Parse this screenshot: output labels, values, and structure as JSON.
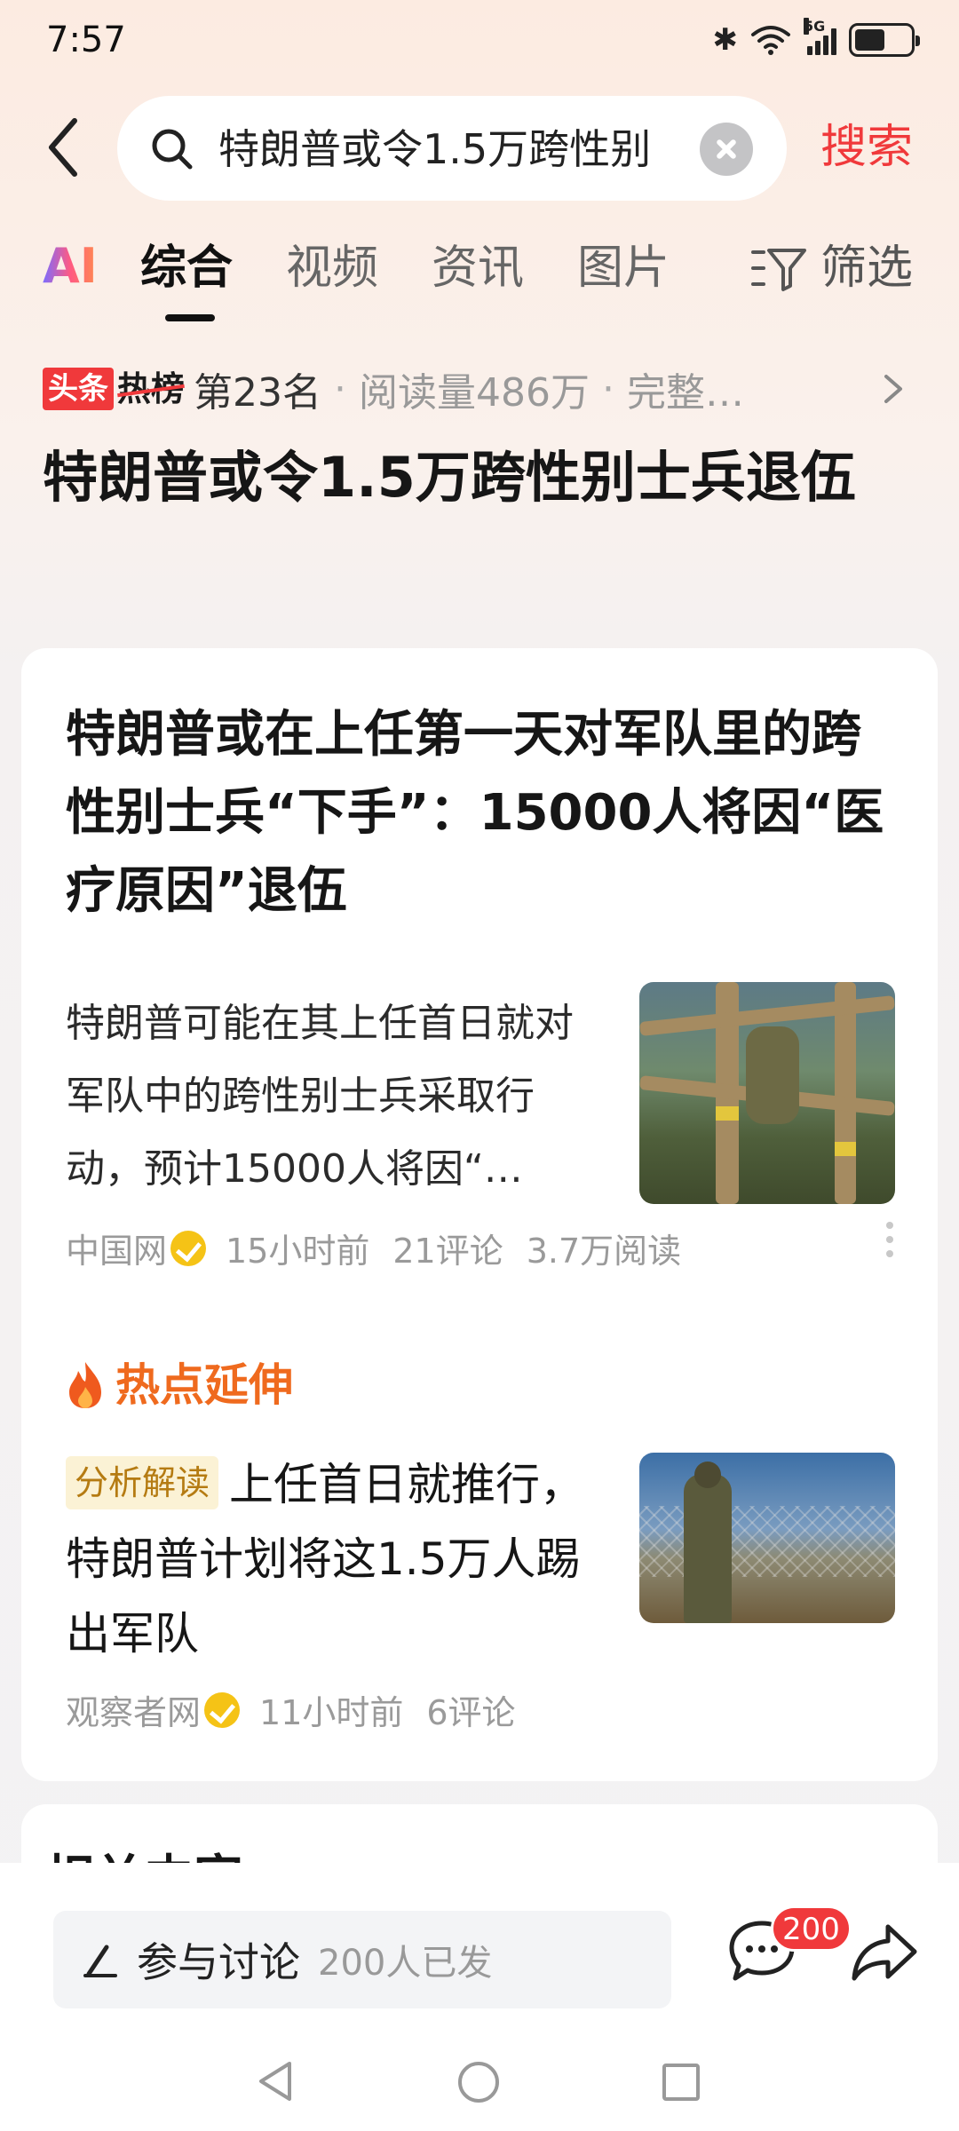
{
  "status_bar": {
    "time": "7:57",
    "network": "5G",
    "battery_level": 0.55
  },
  "search": {
    "query": "特朗普或令1.5万跨性别",
    "submit_label": "搜索"
  },
  "tabs": {
    "ai_label": "AI",
    "items": [
      "综合",
      "视频",
      "资讯",
      "图片"
    ],
    "active_index": 0,
    "filter_label": "筛选"
  },
  "hot_list": {
    "badge_a": "头条",
    "badge_b": "热榜",
    "rank": "第23名",
    "reads": "阅读量486万",
    "extra": "完整…"
  },
  "topic_title": "特朗普或令1.5万跨性别士兵退伍",
  "article1": {
    "title": "特朗普或在上任第一天对军队里的跨性别士兵“下手”：15000人将因“医疗原因”退伍",
    "snippet": "特朗普可能在其上任首日就对军队中的跨性别士兵采取行动，预计15000人将因“…",
    "source": "中国网",
    "time": "15小时前",
    "comments": "21评论",
    "reads": "3.7万阅读"
  },
  "hot_extension": {
    "label": "热点延伸",
    "tag": "分析解读",
    "title": "上任首日就推行，特朗普计划将这1.5万人踢出军队",
    "source": "观察者网",
    "time": "11小时前",
    "comments": "6评论"
  },
  "related": {
    "title": "相关内容"
  },
  "bottom_bar": {
    "discuss_label": "参与讨论",
    "discuss_count": "200人已发",
    "comment_badge": "200"
  },
  "colors": {
    "accent_red": "#f0393b",
    "hot_orange": "#ef6a1e",
    "verified_yellow": "#f5c316",
    "tag_text": "#b57b12"
  },
  "icons": {
    "back": "chevron-left-icon",
    "search": "search-icon",
    "clear": "clear-icon",
    "filter": "filter-icon",
    "flame": "flame-icon",
    "comment": "comment-icon",
    "share": "share-icon",
    "pen": "pen-icon"
  }
}
